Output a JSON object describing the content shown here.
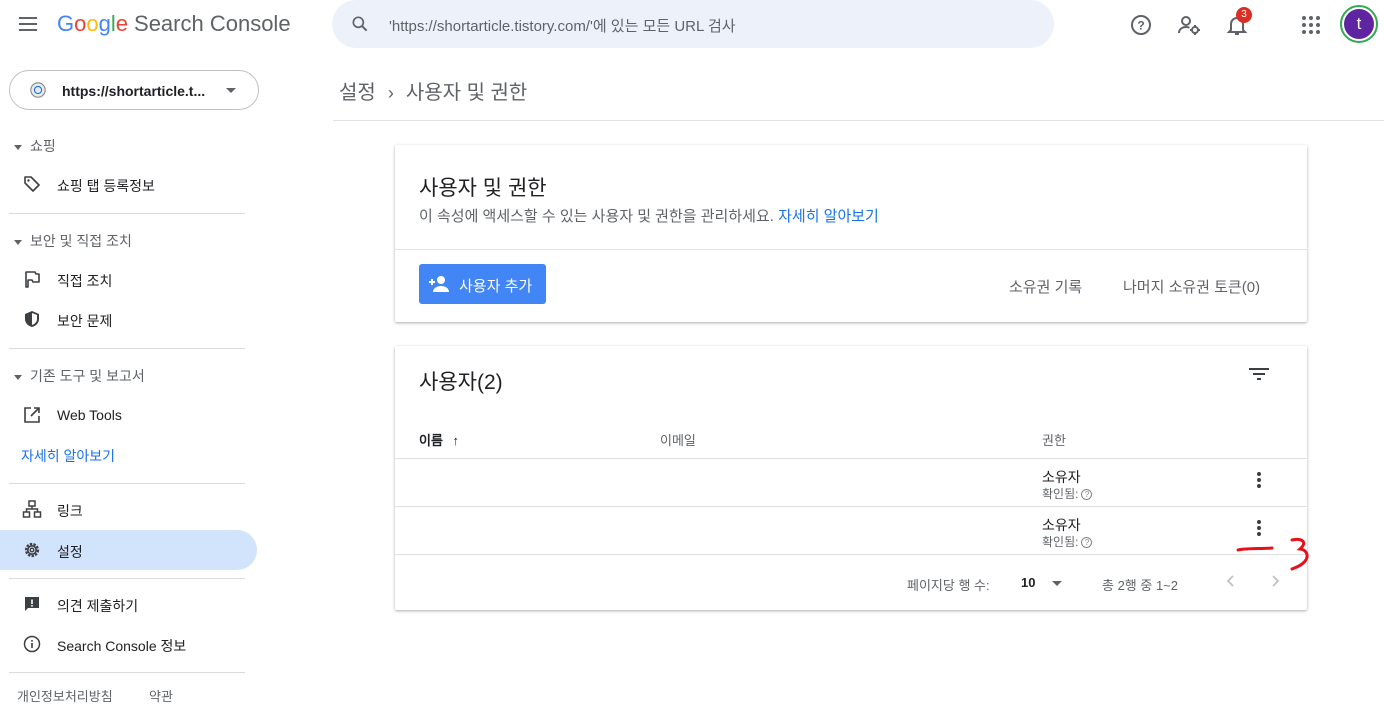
{
  "header": {
    "logo_letters": [
      "G",
      "o",
      "o",
      "g",
      "l",
      "e"
    ],
    "app_name": "Search Console",
    "search_placeholder": "'https://shortarticle.tistory.com/'에 있는 모든 URL 검사",
    "notification_count": "3",
    "avatar_letter": "t"
  },
  "sidebar": {
    "property": "https://shortarticle.t...",
    "sections": [
      {
        "title": "쇼핑",
        "items": [
          "쇼핑 탭 등록정보"
        ]
      },
      {
        "title": "보안 및 직접 조치",
        "items": [
          "직접 조치",
          "보안 문제"
        ]
      },
      {
        "title": "기존 도구 및 보고서",
        "items": [
          "Web Tools"
        ]
      }
    ],
    "learn_more": "자세히 알아보기",
    "links": "링크",
    "settings": "설정",
    "feedback": "의견 제출하기",
    "about": "Search Console 정보",
    "footer": {
      "privacy": "개인정보처리방침",
      "terms": "약관"
    }
  },
  "breadcrumb": {
    "parent": "설정",
    "separator": "›",
    "current": "사용자 및 권한"
  },
  "permissions_card": {
    "title": "사용자 및 권한",
    "description": "이 속성에 액세스할 수 있는 사용자 및 권한을 관리하세요.",
    "learn_more": "자세히 알아보기",
    "add_user": "사용자 추가",
    "ownership_history": "소유권 기록",
    "remaining_tokens": "나머지 소유권 토큰(0)"
  },
  "users_card": {
    "title": "사용자(2)",
    "columns": {
      "name": "이름",
      "sort_arrow": "↑",
      "email": "이메일",
      "permission": "권한"
    },
    "rows": [
      {
        "name": "",
        "email": "",
        "role": "소유자",
        "status": "확인됨:"
      },
      {
        "name": "",
        "email": "",
        "role": "소유자",
        "status": "확인됨:"
      }
    ],
    "help_glyph": "?",
    "pagination": {
      "rows_per_page_label": "페이지당 행 수:",
      "rows_per_page": "10",
      "range": "총 2행 중 1~2"
    }
  },
  "colors": {
    "accent": "#4285f4",
    "active_nav": "#d2e3fc",
    "link": "#1a73e8",
    "annotation": "#e8101a"
  }
}
